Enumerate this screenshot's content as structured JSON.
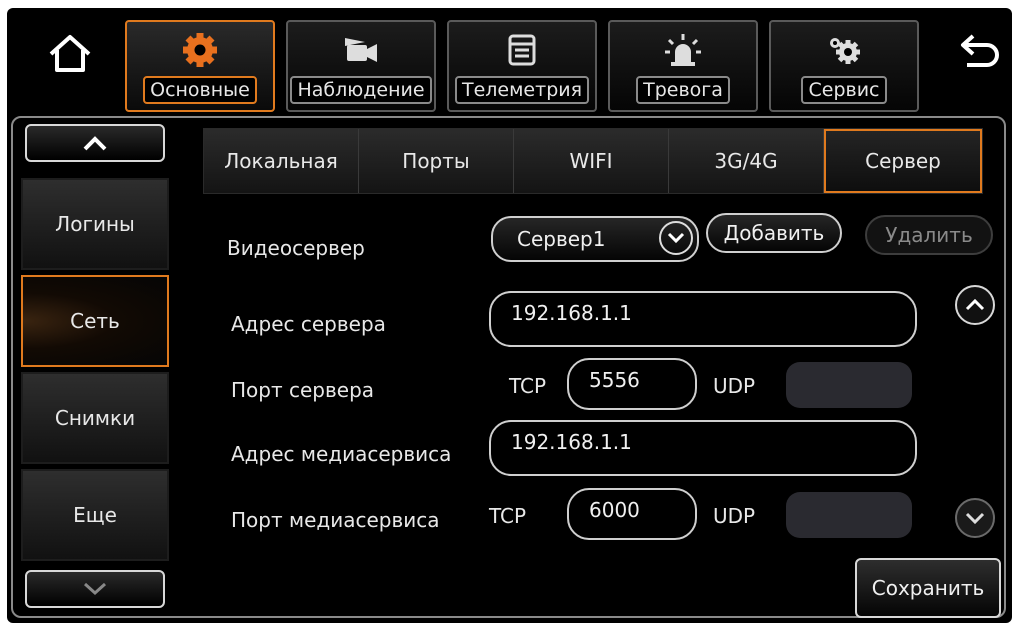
{
  "top_tabs": [
    {
      "label": "Основные",
      "icon": "gear-icon",
      "active": true
    },
    {
      "label": "Наблюдение",
      "icon": "camera-icon",
      "active": false
    },
    {
      "label": "Телеметрия",
      "icon": "document-icon",
      "active": false
    },
    {
      "label": "Тревога",
      "icon": "alarm-light-icon",
      "active": false
    },
    {
      "label": "Сервис",
      "icon": "gears-icon",
      "active": false
    }
  ],
  "sidebar": {
    "items": [
      {
        "label": "Логины"
      },
      {
        "label": "Сеть",
        "active": true
      },
      {
        "label": "Снимки"
      },
      {
        "label": "Еще"
      }
    ]
  },
  "sub_tabs": [
    {
      "label": "Локальная"
    },
    {
      "label": "Порты"
    },
    {
      "label": "WIFI"
    },
    {
      "label": "3G/4G"
    },
    {
      "label": "Сервер",
      "active": true
    }
  ],
  "form": {
    "video_server_label": "Видеосервер",
    "video_server_value": "Сервер1",
    "add_button": "Добавить",
    "delete_button": "Удалить",
    "server_address_label": "Адрес сервера",
    "server_address_value": "192.168.1.1",
    "server_port_label": "Порт сервера",
    "tcp_label": "TCP",
    "udp_label": "UDP",
    "server_tcp_value": "5556",
    "server_udp_value": "",
    "media_address_label": "Адрес медиасервиса",
    "media_address_value": "192.168.1.1",
    "media_port_label": "Порт медиасервиса",
    "media_tcp_value": "6000",
    "media_udp_value": ""
  },
  "save_button": "Сохранить",
  "colors": {
    "accent": "#e07a1e",
    "background": "#000000"
  }
}
